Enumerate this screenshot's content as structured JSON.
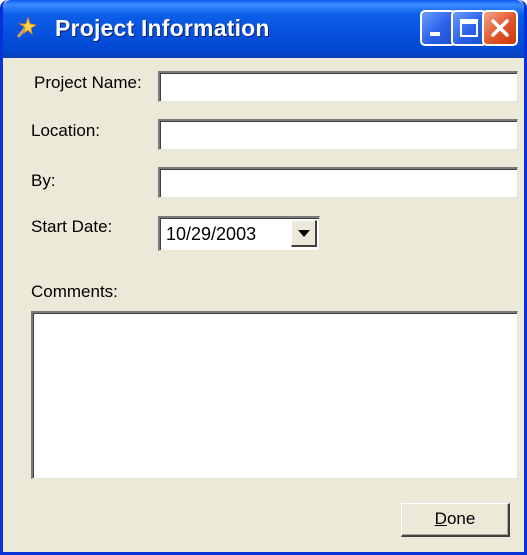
{
  "window": {
    "title": "Project Information",
    "title_bar_color": "#0550dd",
    "close_button_color": "#e0542a",
    "controls": [
      "minimize-icon",
      "maximize-icon",
      "close-icon"
    ],
    "app_icon": "wand-icon"
  },
  "form": {
    "project_name": {
      "label": "Project Name:",
      "value": ""
    },
    "location": {
      "label": "Location:",
      "value": ""
    },
    "by": {
      "label": "By:",
      "value": ""
    },
    "start_date": {
      "label": "Start Date:",
      "value": "10/29/2003"
    },
    "comments": {
      "label": "Comments:",
      "value": ""
    }
  },
  "buttons": {
    "done": {
      "mnemonic": "D",
      "rest": "one"
    }
  }
}
